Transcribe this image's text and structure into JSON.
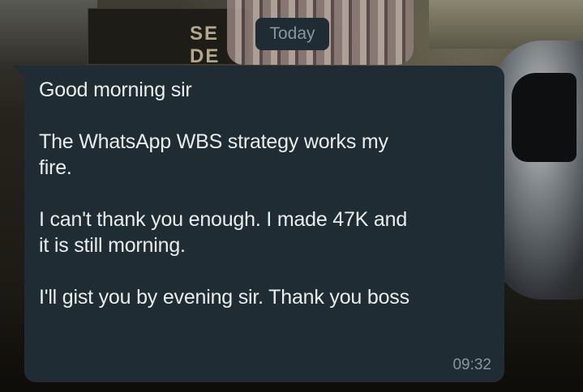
{
  "wallpaper": {
    "sign_text": "SE\nDE"
  },
  "chat": {
    "date_chip": "Today",
    "message": {
      "lines": [
        "Good morning sir",
        "",
        "The WhatsApp WBS strategy works my",
        "fire.",
        "",
        "I can't thank you enough. I made 47K and",
        "it is still morning.",
        "",
        "I'll gist you by evening sir. Thank you boss"
      ],
      "time": "09:32"
    }
  },
  "colors": {
    "bubble_incoming": "#1f2c34",
    "text_primary": "#e9edef",
    "text_secondary": "#8696a0"
  }
}
